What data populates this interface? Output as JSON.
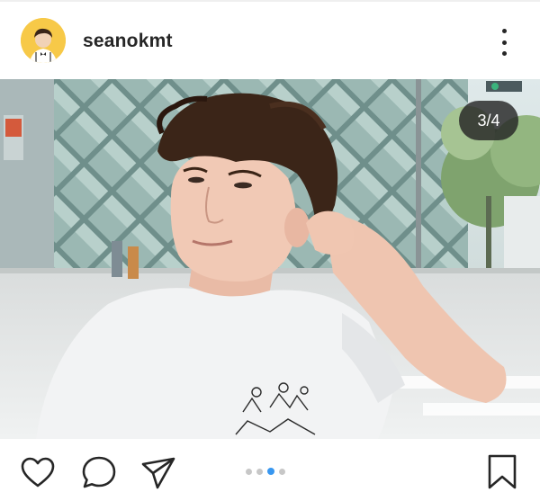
{
  "post": {
    "username": "seanokmt",
    "counter": "3/4",
    "carousel": {
      "total": 4,
      "active_index": 3
    }
  },
  "icons": {
    "avatar": "profile-avatar",
    "more": "more-vertical-icon",
    "like": "heart-icon",
    "comment": "comment-bubble-icon",
    "share": "paper-plane-icon",
    "save": "bookmark-icon"
  },
  "colors": {
    "active_dot": "#3897f0",
    "inactive_dot": "#c7c7c7",
    "text": "#262626",
    "avatar_bg": "#f7c948"
  }
}
